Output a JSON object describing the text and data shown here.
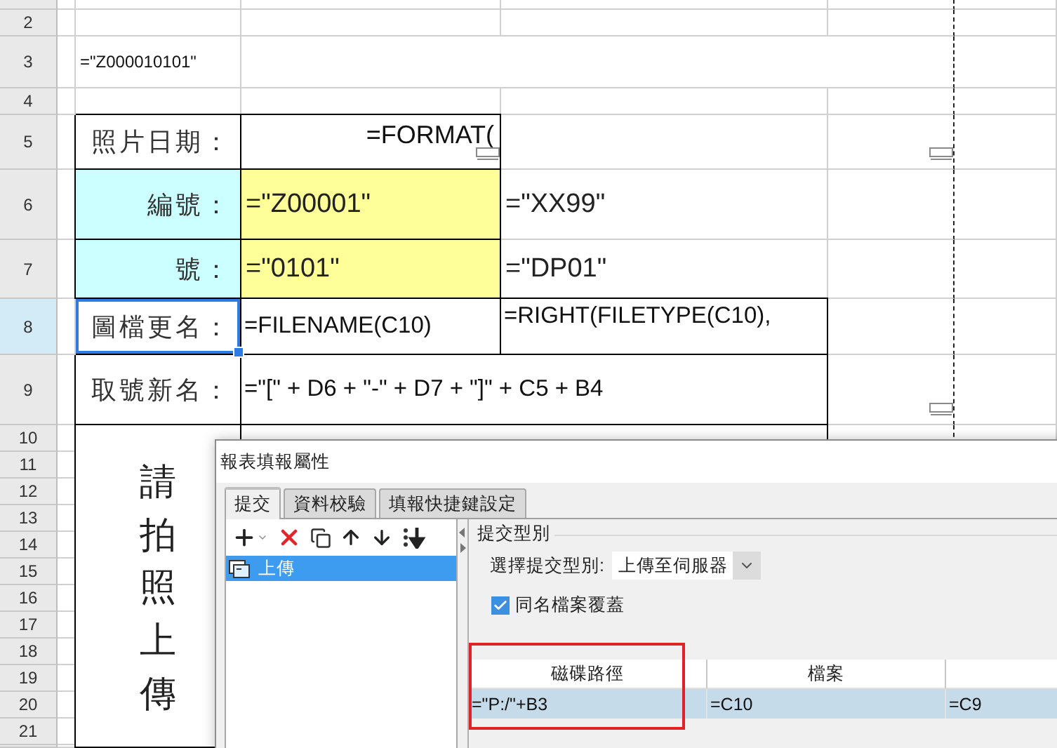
{
  "sheet": {
    "row_headers": [
      {
        "label": "2",
        "selected": false
      },
      {
        "label": "3",
        "selected": false
      },
      {
        "label": "4",
        "selected": false
      },
      {
        "label": "5",
        "selected": false
      },
      {
        "label": "6",
        "selected": false
      },
      {
        "label": "7",
        "selected": false
      },
      {
        "label": "8",
        "selected": true
      },
      {
        "label": "9",
        "selected": false
      },
      {
        "label": "10",
        "selected": false
      },
      {
        "label": "11",
        "selected": false
      },
      {
        "label": "12",
        "selected": false
      },
      {
        "label": "13",
        "selected": false
      },
      {
        "label": "14",
        "selected": false
      },
      {
        "label": "15",
        "selected": false
      },
      {
        "label": "16",
        "selected": false
      },
      {
        "label": "17",
        "selected": false
      },
      {
        "label": "18",
        "selected": false
      },
      {
        "label": "19",
        "selected": false
      },
      {
        "label": "20",
        "selected": false
      },
      {
        "label": "21",
        "selected": false
      }
    ],
    "cells": [
      {
        "kind": "small",
        "text": "=\"Z000010101\"",
        "selected": false
      },
      {
        "kind": "label",
        "text": "照片日期：",
        "selected": false
      },
      {
        "kind": "right",
        "text": "=FORMAT(",
        "selected": false,
        "note": true
      },
      {
        "kind": "label",
        "text": "編號：",
        "selected": false
      },
      {
        "kind": "value",
        "text": "=\"Z00001\"",
        "selected": false
      },
      {
        "kind": "value",
        "text": "=\"XX99\"",
        "selected": false
      },
      {
        "kind": "label",
        "text": "號：",
        "selected": false
      },
      {
        "kind": "value",
        "text": "=\"0101\"",
        "selected": false
      },
      {
        "kind": "value",
        "text": "=\"DP01\"",
        "selected": false
      },
      {
        "kind": "label",
        "text": "圖檔更名：",
        "selected": true
      },
      {
        "kind": "formula",
        "text": "=FILENAME(C10)",
        "selected": false
      },
      {
        "kind": "formula-top",
        "text": "=RIGHT(FILETYPE(C10),",
        "selected": false
      },
      {
        "kind": "label",
        "text": "取號新名：",
        "selected": false
      },
      {
        "kind": "formula",
        "text": "=\"[\" + D6 + \"-\" + D7 + \"]\" + C5 + B4",
        "selected": false
      },
      {
        "kind": "vertical",
        "text": "請拍照上傳",
        "selected": false
      },
      {
        "kind": "blank",
        "selected": false,
        "note": true
      },
      {
        "kind": "blank",
        "selected": false,
        "note": true
      }
    ]
  },
  "dialog": {
    "title": "報表填報屬性",
    "tabs": [
      {
        "label": "提交",
        "selected": true
      },
      {
        "label": "資料校驗",
        "selected": false
      },
      {
        "label": "填報快捷鍵設定",
        "selected": false
      }
    ],
    "list": [
      {
        "label": "上傳",
        "selected": true
      }
    ],
    "group": {
      "legend": "提交型別",
      "select": {
        "label": "選擇提交型別:",
        "value": "上傳至伺服器"
      },
      "checkbox": {
        "label": "同名檔案覆蓋",
        "checked": true
      }
    },
    "table": {
      "columns": [
        "磁碟路徑",
        "檔案"
      ],
      "rows": [
        {
          "cells": [
            "=\"P:/\"+B3",
            "=C10",
            "=C9"
          ],
          "selected": true
        }
      ]
    }
  }
}
